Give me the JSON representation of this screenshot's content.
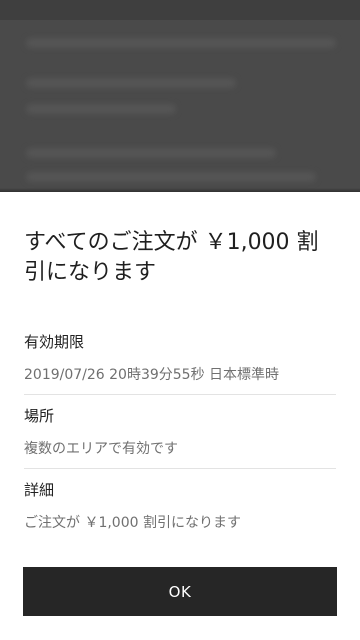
{
  "promo_sheet": {
    "title": "すべてのご注文が ￥1,000 割引になります",
    "sections": [
      {
        "label": "有効期限",
        "value": "2019/07/26 20時39分55秒 日本標準時"
      },
      {
        "label": "場所",
        "value": "複数のエリアで有効です"
      },
      {
        "label": "詳細",
        "value": "ご注文が ￥1,000 割引になります"
      }
    ],
    "ok_label": "OK"
  },
  "colors": {
    "button_bg": "#262626",
    "backdrop": "#4a4a4a"
  }
}
